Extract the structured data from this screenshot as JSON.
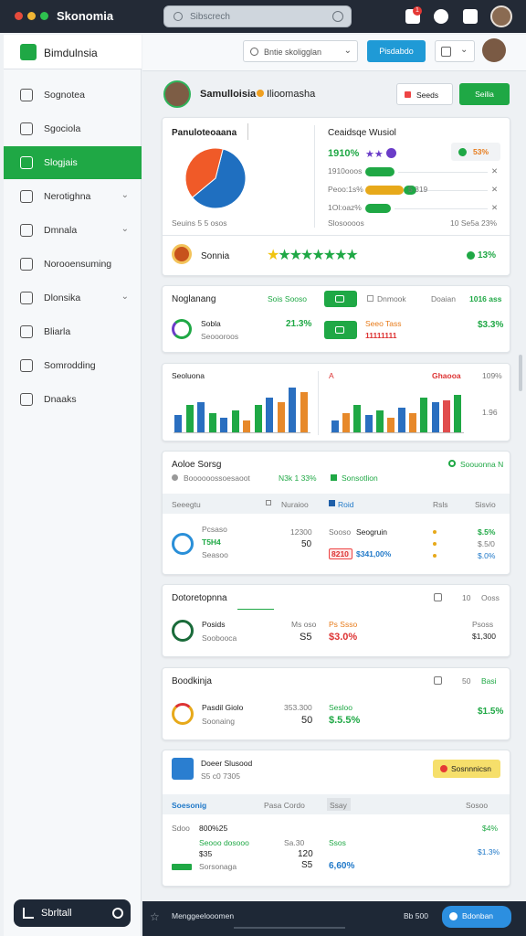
{
  "app": {
    "title": "Skonomia"
  },
  "top": {
    "search_placeholder": "Sibscrech",
    "badge": "1"
  },
  "sidebar": {
    "brand": "Bimdulnsia",
    "items": [
      {
        "label": "Sognotea",
        "chevron": false
      },
      {
        "label": "Sgociola",
        "chevron": false
      },
      {
        "label": "Slogjais",
        "chevron": false,
        "active": true
      },
      {
        "label": "Nerotighna",
        "chevron": true
      },
      {
        "label": "Dmnala",
        "chevron": true
      },
      {
        "label": "Norooensuming",
        "chevron": false
      },
      {
        "label": "Dlonsika",
        "chevron": true
      },
      {
        "label": "Bliarla",
        "chevron": false
      },
      {
        "label": "Somrodding",
        "chevron": false
      },
      {
        "label": "Dnaaks",
        "chevron": false
      }
    ],
    "bottom_button": "Sbrltall"
  },
  "toolbar": {
    "filter_placeholder": "Bntie skoligglan",
    "publish_label": "Pisdabdo"
  },
  "header": {
    "name": "Samulloisia",
    "subtitle": "Ilioomasha",
    "btn_secondary": "Seeds",
    "btn_primary": "Seilia"
  },
  "card1": {
    "left_title": "Panuloteoaana",
    "left_caption": "Seuins 5  5 osos",
    "right_title": "Ceaidsqe Wusiol",
    "right_big": "1910%",
    "right_badge": "53%",
    "rows": [
      {
        "label": "1910ooos",
        "pct": "",
        "ind": ""
      },
      {
        "label": "Peoo:1s%",
        "pct": "5 319",
        "ind": ""
      },
      {
        "label": "1Ol:oaz%",
        "pct": "",
        "ind": ""
      }
    ],
    "right_caption": "Slosoooos",
    "right_caption_val": "10  Se5a 23%",
    "footer_label": "Sonnia",
    "footer_value": "13%"
  },
  "card2": {
    "title": "Noglanang",
    "col1": "Sois  Sooso",
    "col2": "Dnmook",
    "col3": "Doaian",
    "col4": "1016 ass",
    "row_name": "Sobla",
    "row_sub": "Seoooroos",
    "row_pct": "21.3%",
    "row_mid": "Seeo  Tass",
    "row_mid2": "11111111",
    "row_right": "$3.3%"
  },
  "card3": {
    "title": "Seoluona",
    "mid_label": "A",
    "right_badge": "Ghaooa",
    "right_top": "109%",
    "right_side": "1.96",
    "chart_data": [
      {
        "type": "bar",
        "categories": [
          "1",
          "2",
          "3",
          "4",
          "5",
          "6",
          "7",
          "8",
          "9",
          "10",
          "11",
          "12"
        ],
        "series": [
          {
            "name": "",
            "values": [
              35,
              55,
              60,
              40,
              30,
              45,
              25,
              55,
              70,
              60,
              90,
              80
            ]
          }
        ]
      },
      {
        "type": "bar",
        "categories": [
          "1",
          "2",
          "3",
          "4",
          "5",
          "6",
          "7",
          "8",
          "9",
          "10",
          "11",
          "12"
        ],
        "series": [
          {
            "name": "",
            "values": [
              25,
              40,
              55,
              35,
              45,
              30,
              50,
              40,
              70,
              60,
              65,
              75
            ]
          }
        ]
      }
    ]
  },
  "card4": {
    "title": "Aoloe Sorsg",
    "sub": "Boooooossoesaoot",
    "sub_mid": "N3k 1 33%",
    "sub_right": "Sonsotlion",
    "sub_far": "Soouonna N",
    "head": [
      "Seeegtu",
      "Nuraioo",
      "Roid",
      "Rsls",
      "Sisvio"
    ],
    "row_a": "Pcsaso",
    "row_b": "T5H4",
    "row_c": "Seasoo",
    "row_num1": "12300",
    "row_num2": "50",
    "row_tag1": "Sooso",
    "row_tag2": "Seogruin",
    "row_red": "8210",
    "row_blue": "$341,00%",
    "v1": "$.5%",
    "v2": "$.5/0",
    "v3": "$.0%"
  },
  "card5": {
    "title": "Dotoretopnna",
    "right_a": "10",
    "right_b": "Ooss",
    "name": "Posids",
    "sub": "Soobooca",
    "num_a": "Ms oso",
    "num_b": "S5",
    "red_top": "Ps Ssso",
    "red_pct": "$3.0%",
    "right_top": "Psoss",
    "right_val": "$1,300"
  },
  "card6": {
    "title": "Boodkinja",
    "right_a": "50",
    "right_b": "Basi",
    "name": "Pasdil Giolo",
    "sub": "Soonaing",
    "num_a": "353.300",
    "num_b": "50",
    "green_top": "Sesloo",
    "green_pct": "$.5.5%",
    "right_val": "$1.5%"
  },
  "card7": {
    "title": "Doeer Slusood",
    "sub": "S5 c0  7305",
    "badge": "Sosnnnicsn",
    "head": [
      "Soesonig",
      "Pasa  Cordo",
      "Ssay",
      "Sosoo"
    ],
    "r1_label": "Sdoo",
    "r1_val": "800%25",
    "r1_right": "$4%",
    "r2_label": "Seooo dosooo",
    "r2_sub": "$35",
    "r2_num": "Sa.30",
    "r2_mid": "Ssos",
    "r2_right": "$1.3%",
    "r3_sub": "Sorsonaga",
    "r3_num": "S5",
    "r3_blue": "6,60%",
    "r3_mid": "120"
  },
  "bottom": {
    "label": "Menggeelooomen",
    "right": "Bb  500",
    "button": "Bdonban"
  },
  "colors": {
    "accent": "#1fa845",
    "blue": "#1f9ad6",
    "dark": "#1e2836",
    "red": "#d33333",
    "orange": "#e77b1a"
  }
}
